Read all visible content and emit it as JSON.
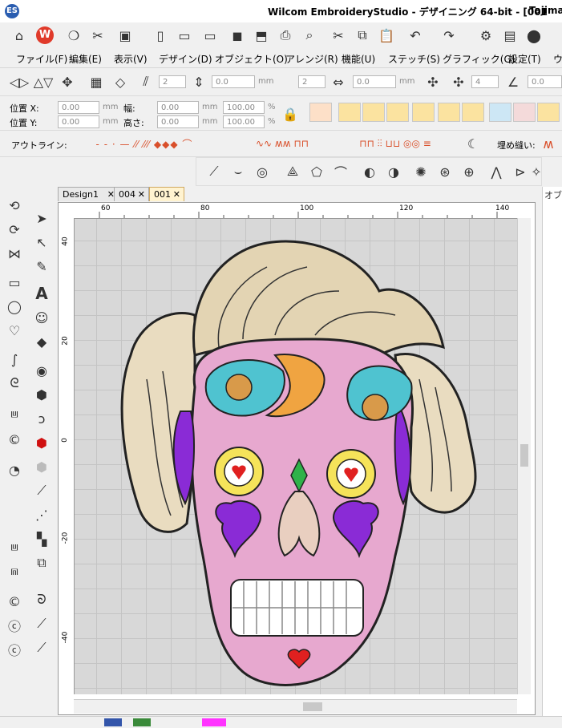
{
  "window": {
    "title": "Wilcom EmbroideryStudio - デザイニング 64-bit - [001",
    "title_suffix": "Tajima]"
  },
  "menu": [
    "ファイル(F)",
    "編集(E)",
    "表示(V)",
    "デザイン(D)",
    "オブジェクト(O)",
    "アレンジ(R)",
    "機能(U)",
    "ステッチ(S)",
    "グラフィック(G)",
    "設定(T)",
    "ウ"
  ],
  "toolbar_fields": {
    "count_a": "2",
    "value_a": "0.0",
    "unit_mm": "mm",
    "count_b": "2",
    "value_b": "0.0",
    "count_c": "4",
    "value_c": "0.0"
  },
  "position": {
    "x_label": "位置 X:",
    "y_label": "位置 Y:",
    "x_value": "0.00",
    "y_value": "0.00",
    "width_label": "幅:",
    "height_label": "高さ:",
    "width_value": "0.00",
    "height_value": "0.00",
    "scale_x": "100.00",
    "scale_y": "100.00",
    "unit_mm": "mm",
    "unit_pct": "%"
  },
  "outline": {
    "label": "アウトライン:",
    "fill_label": "埋め縫い:"
  },
  "tabs": [
    {
      "label": "Design1"
    },
    {
      "label": "004"
    },
    {
      "label": "001"
    }
  ],
  "rulers": {
    "h_ticks": [
      "60",
      "80",
      "100",
      "120",
      "140"
    ],
    "v_ticks": [
      "40",
      "20",
      "0",
      "-20",
      "-40"
    ]
  },
  "right_panel": {
    "title": "オブジ"
  },
  "colors": {
    "accent": "#d94f2a",
    "canvas": "#d8d8d8"
  }
}
